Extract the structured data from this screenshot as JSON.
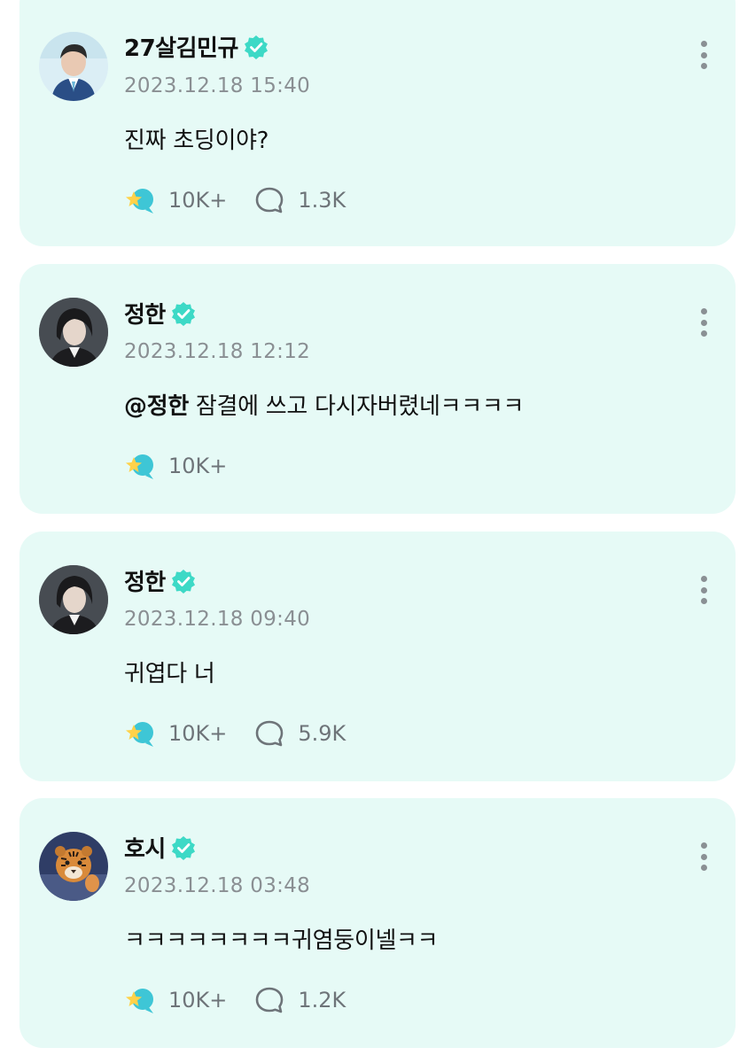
{
  "posts": [
    {
      "author": "27살김민규",
      "timestamp": "2023.12.18 15:40",
      "mention": "",
      "text": "진짜 초딩이야?",
      "likes": "10K+",
      "comments": "1.3K",
      "avatar_icon": "avatar-young-man-blue-suit"
    },
    {
      "author": "정한",
      "timestamp": "2023.12.18 12:12",
      "mention": "@정한",
      "text": " 잠결에 쓰고 다시자버렸네ㅋㅋㅋㅋ",
      "likes": "10K+",
      "comments": "",
      "avatar_icon": "avatar-dark-hair-man"
    },
    {
      "author": "정한",
      "timestamp": "2023.12.18 09:40",
      "mention": "",
      "text": "귀엽다 너",
      "likes": "10K+",
      "comments": "5.9K",
      "avatar_icon": "avatar-dark-hair-man"
    },
    {
      "author": "호시",
      "timestamp": "2023.12.18 03:48",
      "mention": "",
      "text": "ㅋㅋㅋㅋㅋㅋㅋㅋ귀염둥이넬ㅋㅋ",
      "likes": "10K+",
      "comments": "1.2K",
      "avatar_icon": "avatar-tiger"
    }
  ],
  "icons": {
    "verified": "verified-badge-icon",
    "like": "star-bubble-like-icon",
    "comment": "speech-bubble-icon",
    "more": "more-vertical-icon"
  },
  "colors": {
    "card_background": "#e6faf6",
    "verified": "#3dd9c6",
    "like_bubble": "#3ec6d6",
    "like_star": "#ffd24a",
    "timestamp": "#8a8f93"
  }
}
